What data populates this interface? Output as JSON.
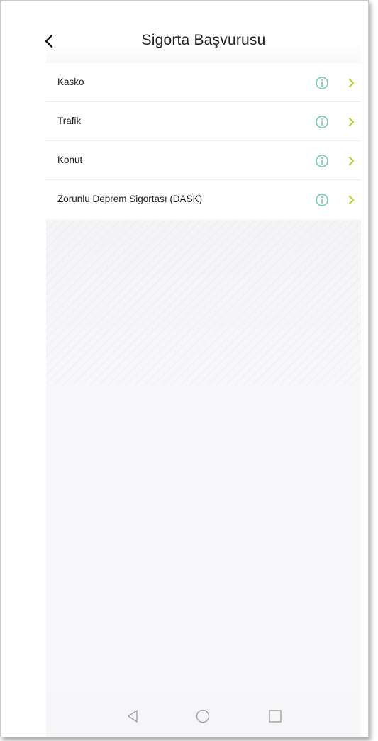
{
  "header": {
    "title": "Sigorta Başvurusu",
    "back_icon": "chevron-left-icon"
  },
  "list": {
    "items": [
      {
        "label": "Kasko"
      },
      {
        "label": "Trafik"
      },
      {
        "label": "Konut"
      },
      {
        "label": "Zorunlu Deprem Sigortası (DASK)"
      }
    ],
    "info_icon": "info-circle-icon",
    "arrow_icon": "chevron-right-icon"
  },
  "nav_bar": {
    "icons": [
      "back-triangle-icon",
      "home-circle-icon",
      "recents-square-icon"
    ]
  },
  "colors": {
    "info_icon": "#5fc7a8",
    "chevron": "#b8cc2a",
    "title_text": "#222222",
    "background": "#f8f8fa"
  }
}
